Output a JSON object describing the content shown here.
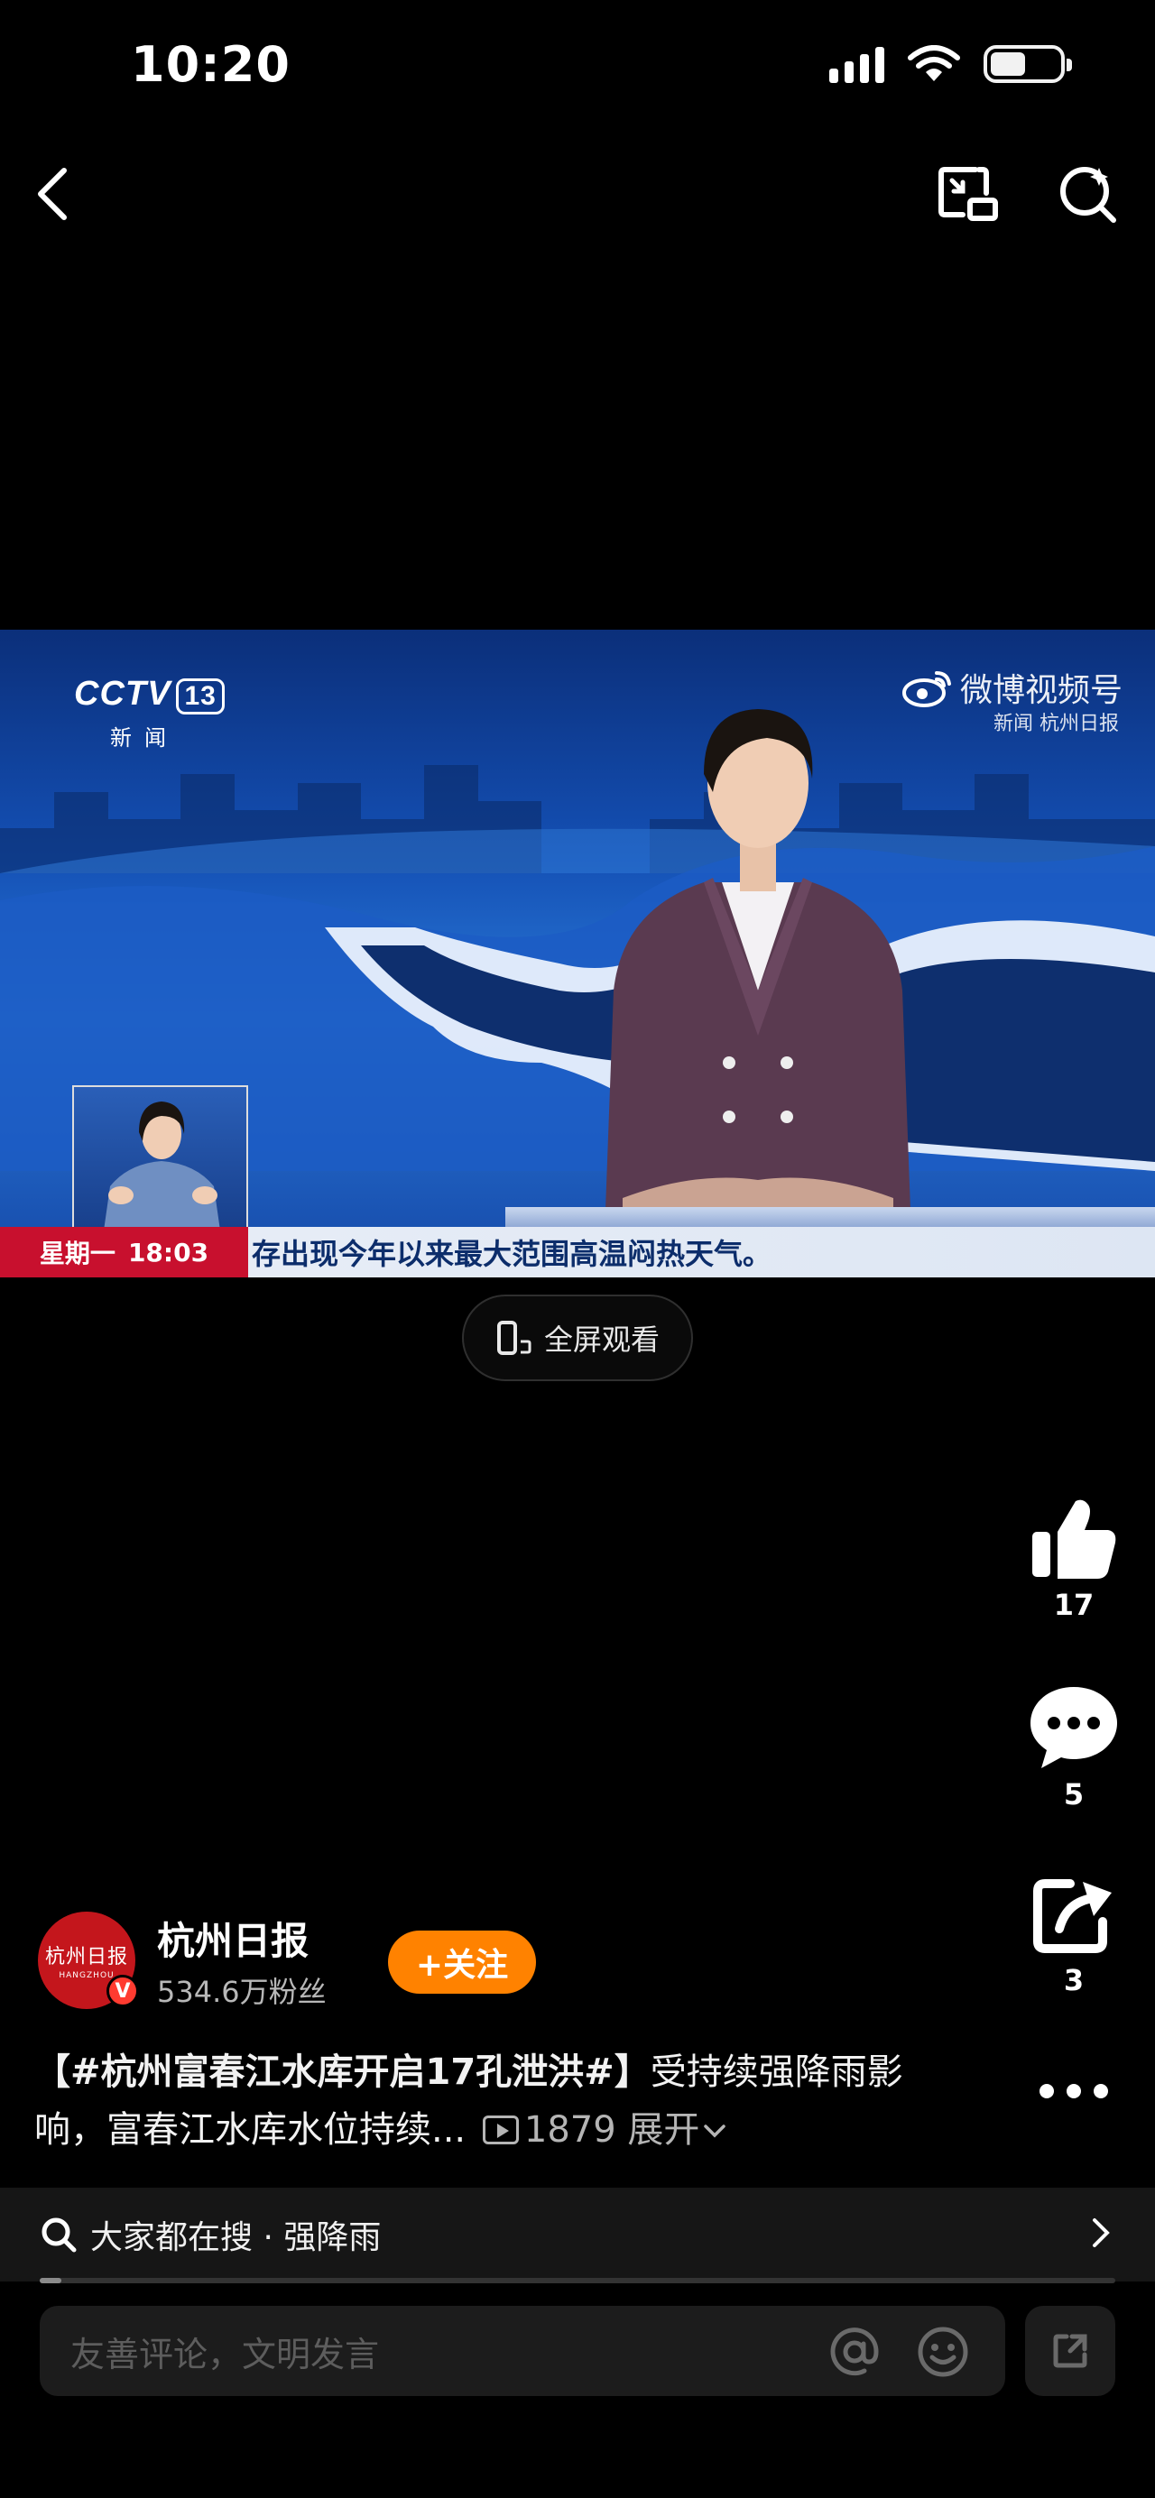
{
  "status_bar": {
    "time": "10:20",
    "battery_level": 0.5
  },
  "video": {
    "channel_logo": "CCTV",
    "channel_number": "13",
    "channel_sub": "新闻",
    "watermark": "微博视频号",
    "watermark_sub": "新闻 杭州日报",
    "ticker_day": "星期一",
    "ticker_time": "18:03",
    "ticker_text": "存出现今年以来最大范围高温闷热天气。",
    "fullscreen_label": "全屏观看"
  },
  "actions": {
    "likes": "17",
    "comments": "5",
    "shares": "3"
  },
  "author": {
    "avatar_text": "杭州日报",
    "avatar_sub": "HANGZHOU",
    "verified_mark": "V",
    "name": "杭州日报",
    "fans": "534.6万粉丝",
    "follow_label": "+关注"
  },
  "caption": {
    "tag": "【#杭州富春江水库开启17孔泄洪#】",
    "text": "受持续强降雨影响，富春江水库水位持续...",
    "plays": "1879",
    "expand": "展开"
  },
  "search": {
    "label": "大家都在搜 · 强降雨",
    "progress": 0.02
  },
  "comment": {
    "placeholder": "友善评论，文明发言"
  },
  "icons": {
    "back": "back-icon",
    "pip": "picture-in-picture-icon",
    "search": "search-icon",
    "like": "thumbs-up-icon",
    "comment": "comment-bubble-icon",
    "share": "share-icon",
    "more": "more-icon",
    "mention": "at-icon",
    "emoji": "emoji-icon",
    "expand": "expand-icon"
  }
}
